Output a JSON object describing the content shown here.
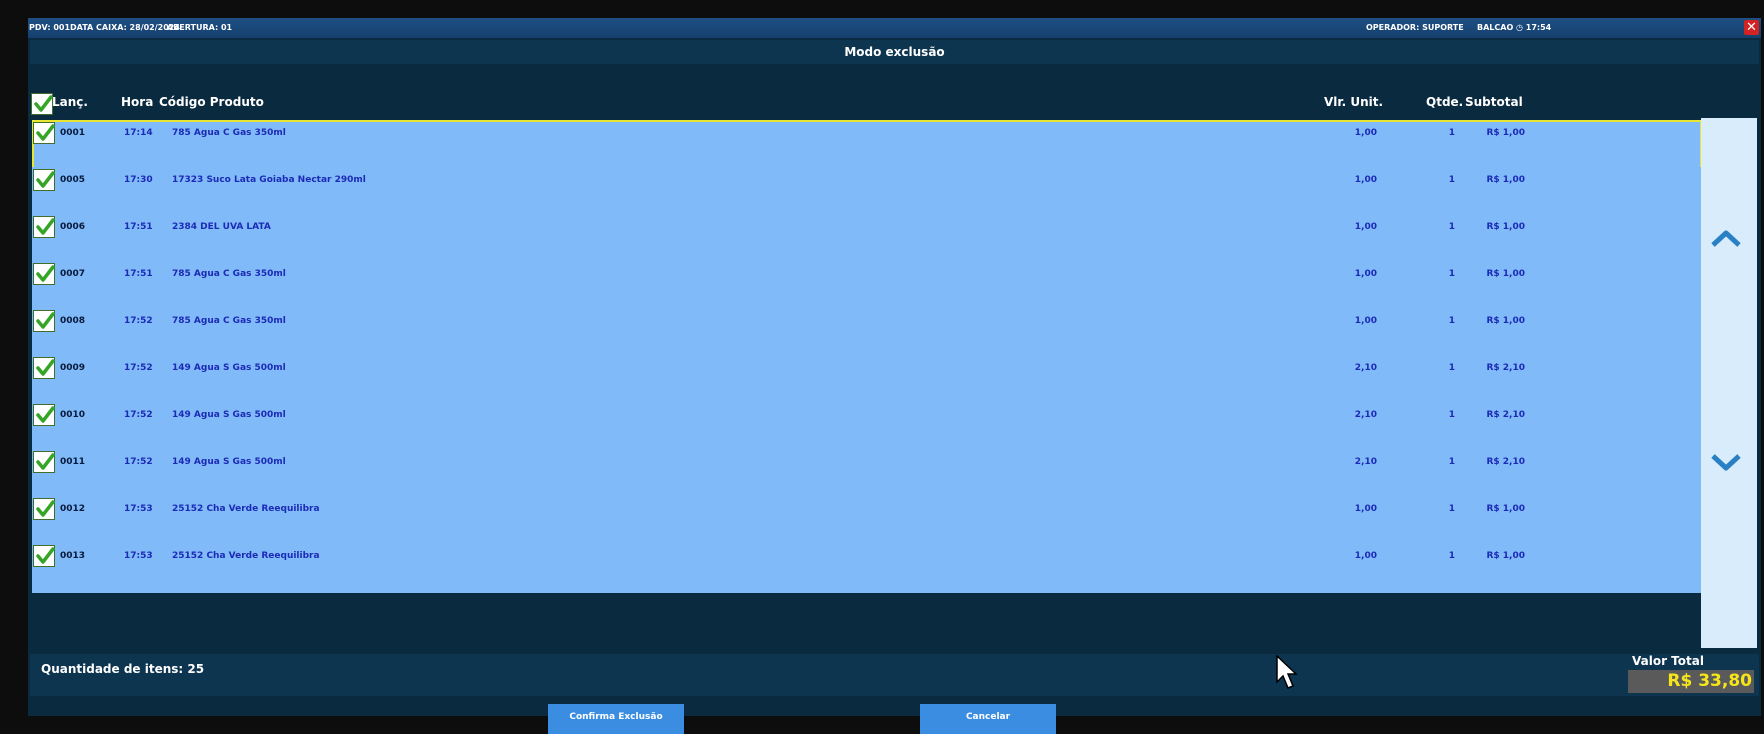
{
  "topbar": {
    "pdv": "PDV: 001",
    "data_caixa": "DATA CAIXA: 28/02/2024",
    "abertura": "ABERTURA: 01",
    "operador": "OPERADOR: SUPORTE",
    "balcao": "BALCAO",
    "clock": "◷ 17:54",
    "close_icon": "✕"
  },
  "mode_title": "Modo exclusão",
  "columns": {
    "lanc": "Lanç.",
    "hora": "Hora",
    "codigo": "Código Produto",
    "vlr_unit": "Vlr. Unit.",
    "qtde": "Qtde.",
    "subtotal": "Subtotal"
  },
  "rows": [
    {
      "lanc": "0001",
      "hora": "17:14",
      "codigo": "785 Agua C Gas 350ml",
      "vlr": "1,00",
      "qtd": "1",
      "sub": "R$ 1,00",
      "checked": true,
      "selected": true
    },
    {
      "lanc": "0005",
      "hora": "17:30",
      "codigo": "17323 Suco Lata Goiaba Nectar 290ml",
      "vlr": "1,00",
      "qtd": "1",
      "sub": "R$ 1,00",
      "checked": true
    },
    {
      "lanc": "0006",
      "hora": "17:51",
      "codigo": "2384 DEL UVA LATA",
      "vlr": "1,00",
      "qtd": "1",
      "sub": "R$ 1,00",
      "checked": true
    },
    {
      "lanc": "0007",
      "hora": "17:51",
      "codigo": "785 Agua C Gas 350ml",
      "vlr": "1,00",
      "qtd": "1",
      "sub": "R$ 1,00",
      "checked": true
    },
    {
      "lanc": "0008",
      "hora": "17:52",
      "codigo": "785 Agua C Gas 350ml",
      "vlr": "1,00",
      "qtd": "1",
      "sub": "R$ 1,00",
      "checked": true
    },
    {
      "lanc": "0009",
      "hora": "17:52",
      "codigo": "149 Agua S Gas 500ml",
      "vlr": "2,10",
      "qtd": "1",
      "sub": "R$ 2,10",
      "checked": true
    },
    {
      "lanc": "0010",
      "hora": "17:52",
      "codigo": "149 Agua S Gas 500ml",
      "vlr": "2,10",
      "qtd": "1",
      "sub": "R$ 2,10",
      "checked": true
    },
    {
      "lanc": "0011",
      "hora": "17:52",
      "codigo": "149 Agua S Gas 500ml",
      "vlr": "2,10",
      "qtd": "1",
      "sub": "R$ 2,10",
      "checked": true
    },
    {
      "lanc": "0012",
      "hora": "17:53",
      "codigo": "25152 Cha Verde Reequilibra",
      "vlr": "1,00",
      "qtd": "1",
      "sub": "R$ 1,00",
      "checked": true
    },
    {
      "lanc": "0013",
      "hora": "17:53",
      "codigo": "25152 Cha Verde Reequilibra",
      "vlr": "1,00",
      "qtd": "1",
      "sub": "R$ 1,00",
      "checked": true
    }
  ],
  "footer": {
    "quantidade": "Quantidade de itens: 25",
    "valor_total_label": "Valor Total",
    "valor_total": "R$ 33,80"
  },
  "buttons": {
    "confirma": "Confirma Exclusão",
    "cancelar": "Cancelar"
  },
  "colors": {
    "row_bg": "#80baf9",
    "selected_outline": "#e8e635",
    "text_blue": "#1c2bb6",
    "total_yellow": "#f5e61b"
  }
}
